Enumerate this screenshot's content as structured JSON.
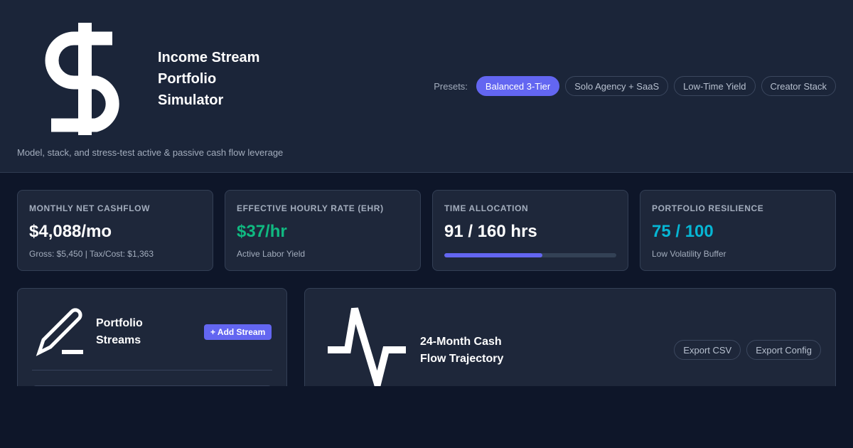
{
  "header": {
    "logo_icon": "dollar-sign-icon",
    "title_line1": "Income Stream",
    "title_line2": "Portfolio",
    "title_line3": "Simulator",
    "tagline": "Model, stack, and stress-test active & passive cash flow leverage"
  },
  "presets": {
    "label": "Presets:",
    "items": [
      "Balanced 3-Tier",
      "Solo Agency + SaaS",
      "Low-Time Yield",
      "Creator Stack"
    ],
    "active": "Balanced 3-Tier"
  },
  "metrics": {
    "cashflow": {
      "label": "Monthly Net Cashflow",
      "value": "$4,088/mo",
      "sub": "Gross: $5,450 | Tax/Cost: $1,363"
    },
    "ehr": {
      "label": "Effective Hourly Rate (EHR)",
      "value": "$37/hr",
      "sub": "Active Labor Yield"
    },
    "time": {
      "label": "Time Allocation",
      "value": "91 / 160 hrs",
      "used_hours": 91,
      "total_hours": 160
    },
    "resilience": {
      "label": "Portfolio Resilience",
      "value": "75 / 100",
      "sub": "Low Volatility Buffer"
    }
  },
  "streams_panel": {
    "icon": "pencil-icon",
    "title_line1": "Portfolio",
    "title_line2": "Streams",
    "add_button": "+ Add Stream"
  },
  "trajectory_panel": {
    "icon": "activity-pulse-icon",
    "title_line1": "24-Month Cash",
    "title_line2": "Flow Trajectory",
    "export_csv": "Export CSV",
    "export_config": "Export Config"
  },
  "colors": {
    "accent": "#6366f1",
    "positive": "#10b981",
    "info": "#06b6d4",
    "header_bg": "#1b2539",
    "page_bg": "#0e1629",
    "card_bg": "#1e273a"
  }
}
